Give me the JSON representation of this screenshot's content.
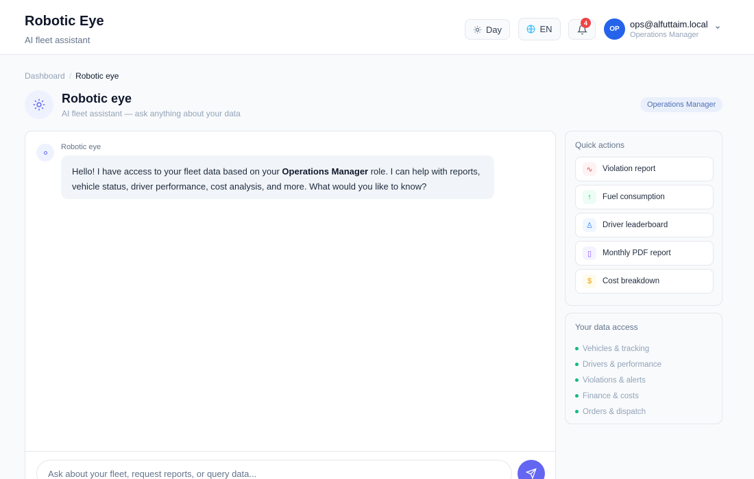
{
  "header": {
    "title": "Robotic Eye",
    "subtitle": "AI fleet assistant",
    "theme_label": "Day",
    "lang_label": "EN",
    "notification_count": "4",
    "user": {
      "initials": "OP",
      "email": "ops@alfuttaim.local",
      "role": "Operations Manager"
    }
  },
  "breadcrumb": {
    "parent": "Dashboard",
    "separator": "/",
    "current": "Robotic eye"
  },
  "page": {
    "title": "Robotic eye",
    "subtitle": "AI fleet assistant — ask anything about your data",
    "role_chip": "Operations Manager"
  },
  "chat": {
    "messages": [
      {
        "sender": "Robotic eye",
        "text_before": "Hello! I have access to your fleet data based on your ",
        "text_bold": "Operations Manager",
        "text_after": " role. I can help with reports, vehicle status, driver performance, cost analysis, and more. What would you like to know?"
      }
    ],
    "input_placeholder": "Ask about your fleet, request reports, or query data..."
  },
  "quick_actions": {
    "title": "Quick actions",
    "items": [
      {
        "label": "Violation report",
        "icon": "activity-icon",
        "glyph": "∿",
        "color": "#ef4444",
        "bg": "#fef2f2"
      },
      {
        "label": "Fuel consumption",
        "icon": "arrow-up-icon",
        "glyph": "↑",
        "color": "#10b981",
        "bg": "#ecfdf5"
      },
      {
        "label": "Driver leaderboard",
        "icon": "user-icon",
        "glyph": "♙",
        "color": "#3b82f6",
        "bg": "#eff6ff"
      },
      {
        "label": "Monthly PDF report",
        "icon": "file-icon",
        "glyph": "▯",
        "color": "#8b5cf6",
        "bg": "#f5f3ff"
      },
      {
        "label": "Cost breakdown",
        "icon": "dollar-icon",
        "glyph": "$",
        "color": "#f59e0b",
        "bg": "#fffbeb"
      }
    ]
  },
  "data_access": {
    "title": "Your data access",
    "items": [
      "Vehicles & tracking",
      "Drivers & performance",
      "Violations & alerts",
      "Finance & costs",
      "Orders & dispatch"
    ]
  },
  "colors": {
    "accent": "#6366f1",
    "badge": "#ef4444",
    "avatar": "#2563eb",
    "access_dot": "#10b981"
  }
}
